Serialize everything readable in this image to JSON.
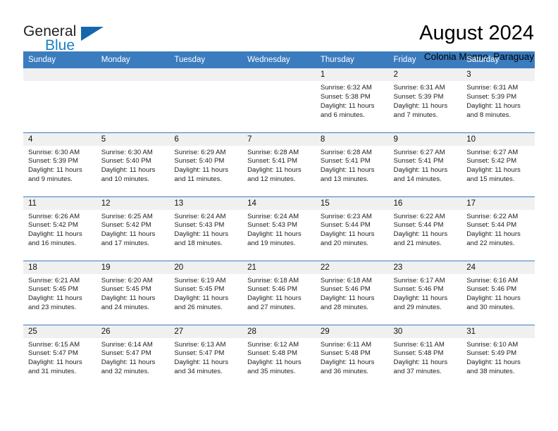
{
  "brand": {
    "line1": "General",
    "line2": "Blue",
    "triangle_color": "#1567ad"
  },
  "header": {
    "title": "August 2024",
    "subtitle": "Colonia Menno, Paraguay"
  },
  "theme": {
    "header_blue": "#3b7cbf",
    "daynum_bg": "#f0f0f0",
    "brand_blue": "#1a7fc1"
  },
  "weekday_headers": [
    "Sunday",
    "Monday",
    "Tuesday",
    "Wednesday",
    "Thursday",
    "Friday",
    "Saturday"
  ],
  "labels": {
    "sunrise_prefix": "Sunrise:",
    "sunset_prefix": "Sunset:",
    "daylight_prefix": "Daylight:"
  },
  "weeks": [
    [
      {
        "day": "",
        "empty": true
      },
      {
        "day": "",
        "empty": true
      },
      {
        "day": "",
        "empty": true
      },
      {
        "day": "",
        "empty": true
      },
      {
        "day": "1",
        "sunrise": "Sunrise: 6:32 AM",
        "sunset": "Sunset: 5:38 PM",
        "daylight_line1": "Daylight: 11 hours",
        "daylight_line2": "and 6 minutes."
      },
      {
        "day": "2",
        "sunrise": "Sunrise: 6:31 AM",
        "sunset": "Sunset: 5:39 PM",
        "daylight_line1": "Daylight: 11 hours",
        "daylight_line2": "and 7 minutes."
      },
      {
        "day": "3",
        "sunrise": "Sunrise: 6:31 AM",
        "sunset": "Sunset: 5:39 PM",
        "daylight_line1": "Daylight: 11 hours",
        "daylight_line2": "and 8 minutes."
      }
    ],
    [
      {
        "day": "4",
        "sunrise": "Sunrise: 6:30 AM",
        "sunset": "Sunset: 5:39 PM",
        "daylight_line1": "Daylight: 11 hours",
        "daylight_line2": "and 9 minutes."
      },
      {
        "day": "5",
        "sunrise": "Sunrise: 6:30 AM",
        "sunset": "Sunset: 5:40 PM",
        "daylight_line1": "Daylight: 11 hours",
        "daylight_line2": "and 10 minutes."
      },
      {
        "day": "6",
        "sunrise": "Sunrise: 6:29 AM",
        "sunset": "Sunset: 5:40 PM",
        "daylight_line1": "Daylight: 11 hours",
        "daylight_line2": "and 11 minutes."
      },
      {
        "day": "7",
        "sunrise": "Sunrise: 6:28 AM",
        "sunset": "Sunset: 5:41 PM",
        "daylight_line1": "Daylight: 11 hours",
        "daylight_line2": "and 12 minutes."
      },
      {
        "day": "8",
        "sunrise": "Sunrise: 6:28 AM",
        "sunset": "Sunset: 5:41 PM",
        "daylight_line1": "Daylight: 11 hours",
        "daylight_line2": "and 13 minutes."
      },
      {
        "day": "9",
        "sunrise": "Sunrise: 6:27 AM",
        "sunset": "Sunset: 5:41 PM",
        "daylight_line1": "Daylight: 11 hours",
        "daylight_line2": "and 14 minutes."
      },
      {
        "day": "10",
        "sunrise": "Sunrise: 6:27 AM",
        "sunset": "Sunset: 5:42 PM",
        "daylight_line1": "Daylight: 11 hours",
        "daylight_line2": "and 15 minutes."
      }
    ],
    [
      {
        "day": "11",
        "sunrise": "Sunrise: 6:26 AM",
        "sunset": "Sunset: 5:42 PM",
        "daylight_line1": "Daylight: 11 hours",
        "daylight_line2": "and 16 minutes."
      },
      {
        "day": "12",
        "sunrise": "Sunrise: 6:25 AM",
        "sunset": "Sunset: 5:42 PM",
        "daylight_line1": "Daylight: 11 hours",
        "daylight_line2": "and 17 minutes."
      },
      {
        "day": "13",
        "sunrise": "Sunrise: 6:24 AM",
        "sunset": "Sunset: 5:43 PM",
        "daylight_line1": "Daylight: 11 hours",
        "daylight_line2": "and 18 minutes."
      },
      {
        "day": "14",
        "sunrise": "Sunrise: 6:24 AM",
        "sunset": "Sunset: 5:43 PM",
        "daylight_line1": "Daylight: 11 hours",
        "daylight_line2": "and 19 minutes."
      },
      {
        "day": "15",
        "sunrise": "Sunrise: 6:23 AM",
        "sunset": "Sunset: 5:44 PM",
        "daylight_line1": "Daylight: 11 hours",
        "daylight_line2": "and 20 minutes."
      },
      {
        "day": "16",
        "sunrise": "Sunrise: 6:22 AM",
        "sunset": "Sunset: 5:44 PM",
        "daylight_line1": "Daylight: 11 hours",
        "daylight_line2": "and 21 minutes."
      },
      {
        "day": "17",
        "sunrise": "Sunrise: 6:22 AM",
        "sunset": "Sunset: 5:44 PM",
        "daylight_line1": "Daylight: 11 hours",
        "daylight_line2": "and 22 minutes."
      }
    ],
    [
      {
        "day": "18",
        "sunrise": "Sunrise: 6:21 AM",
        "sunset": "Sunset: 5:45 PM",
        "daylight_line1": "Daylight: 11 hours",
        "daylight_line2": "and 23 minutes."
      },
      {
        "day": "19",
        "sunrise": "Sunrise: 6:20 AM",
        "sunset": "Sunset: 5:45 PM",
        "daylight_line1": "Daylight: 11 hours",
        "daylight_line2": "and 24 minutes."
      },
      {
        "day": "20",
        "sunrise": "Sunrise: 6:19 AM",
        "sunset": "Sunset: 5:45 PM",
        "daylight_line1": "Daylight: 11 hours",
        "daylight_line2": "and 26 minutes."
      },
      {
        "day": "21",
        "sunrise": "Sunrise: 6:18 AM",
        "sunset": "Sunset: 5:46 PM",
        "daylight_line1": "Daylight: 11 hours",
        "daylight_line2": "and 27 minutes."
      },
      {
        "day": "22",
        "sunrise": "Sunrise: 6:18 AM",
        "sunset": "Sunset: 5:46 PM",
        "daylight_line1": "Daylight: 11 hours",
        "daylight_line2": "and 28 minutes."
      },
      {
        "day": "23",
        "sunrise": "Sunrise: 6:17 AM",
        "sunset": "Sunset: 5:46 PM",
        "daylight_line1": "Daylight: 11 hours",
        "daylight_line2": "and 29 minutes."
      },
      {
        "day": "24",
        "sunrise": "Sunrise: 6:16 AM",
        "sunset": "Sunset: 5:46 PM",
        "daylight_line1": "Daylight: 11 hours",
        "daylight_line2": "and 30 minutes."
      }
    ],
    [
      {
        "day": "25",
        "sunrise": "Sunrise: 6:15 AM",
        "sunset": "Sunset: 5:47 PM",
        "daylight_line1": "Daylight: 11 hours",
        "daylight_line2": "and 31 minutes."
      },
      {
        "day": "26",
        "sunrise": "Sunrise: 6:14 AM",
        "sunset": "Sunset: 5:47 PM",
        "daylight_line1": "Daylight: 11 hours",
        "daylight_line2": "and 32 minutes."
      },
      {
        "day": "27",
        "sunrise": "Sunrise: 6:13 AM",
        "sunset": "Sunset: 5:47 PM",
        "daylight_line1": "Daylight: 11 hours",
        "daylight_line2": "and 34 minutes."
      },
      {
        "day": "28",
        "sunrise": "Sunrise: 6:12 AM",
        "sunset": "Sunset: 5:48 PM",
        "daylight_line1": "Daylight: 11 hours",
        "daylight_line2": "and 35 minutes."
      },
      {
        "day": "29",
        "sunrise": "Sunrise: 6:11 AM",
        "sunset": "Sunset: 5:48 PM",
        "daylight_line1": "Daylight: 11 hours",
        "daylight_line2": "and 36 minutes."
      },
      {
        "day": "30",
        "sunrise": "Sunrise: 6:11 AM",
        "sunset": "Sunset: 5:48 PM",
        "daylight_line1": "Daylight: 11 hours",
        "daylight_line2": "and 37 minutes."
      },
      {
        "day": "31",
        "sunrise": "Sunrise: 6:10 AM",
        "sunset": "Sunset: 5:49 PM",
        "daylight_line1": "Daylight: 11 hours",
        "daylight_line2": "and 38 minutes."
      }
    ]
  ]
}
